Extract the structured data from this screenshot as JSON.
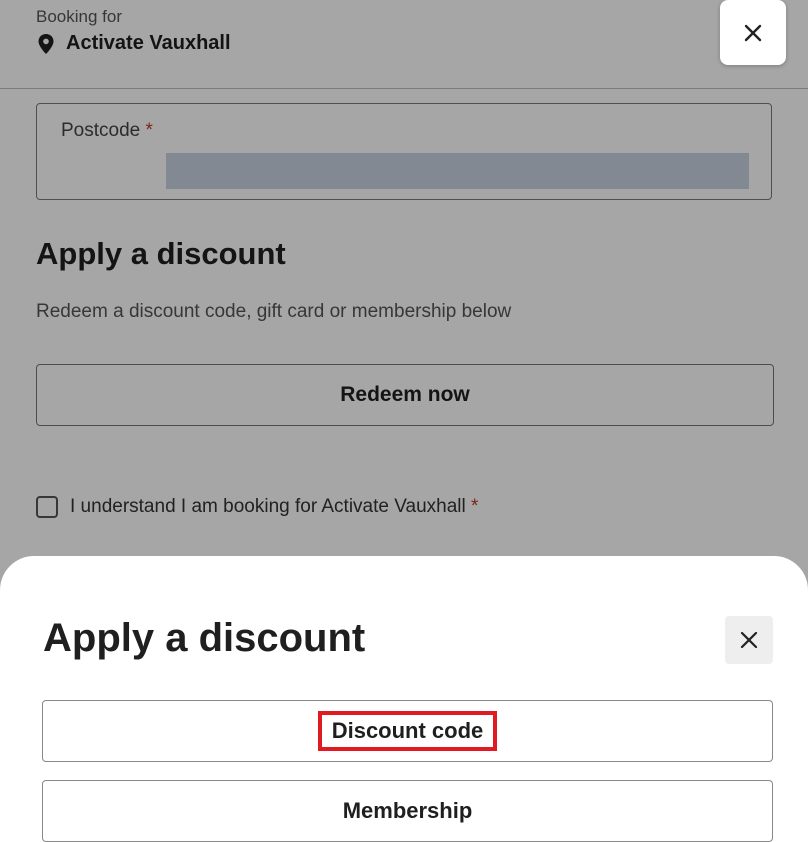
{
  "header": {
    "booking_for_label": "Booking for",
    "location_name": "Activate Vauxhall",
    "location_icon": "map-pin-icon",
    "close_icon": "close-icon"
  },
  "form": {
    "postcode_label": "Postcode",
    "required_marker": "*",
    "postcode_value": ""
  },
  "discount_section": {
    "heading": "Apply a discount",
    "subtitle": "Redeem a discount code, gift card or membership below",
    "redeem_button": "Redeem now"
  },
  "acknowledgement": {
    "label": "I understand I am booking for Activate Vauxhall",
    "required_marker": "*",
    "checked": false
  },
  "discount_sheet": {
    "title": "Apply a discount",
    "close_icon": "close-icon",
    "options": [
      {
        "label": "Discount code",
        "highlighted": true
      },
      {
        "label": "Membership",
        "highlighted": false
      }
    ]
  },
  "colors": {
    "required": "#c0392b",
    "highlight": "#e11b22",
    "overlay": "rgba(0,0,0,0.35)"
  }
}
